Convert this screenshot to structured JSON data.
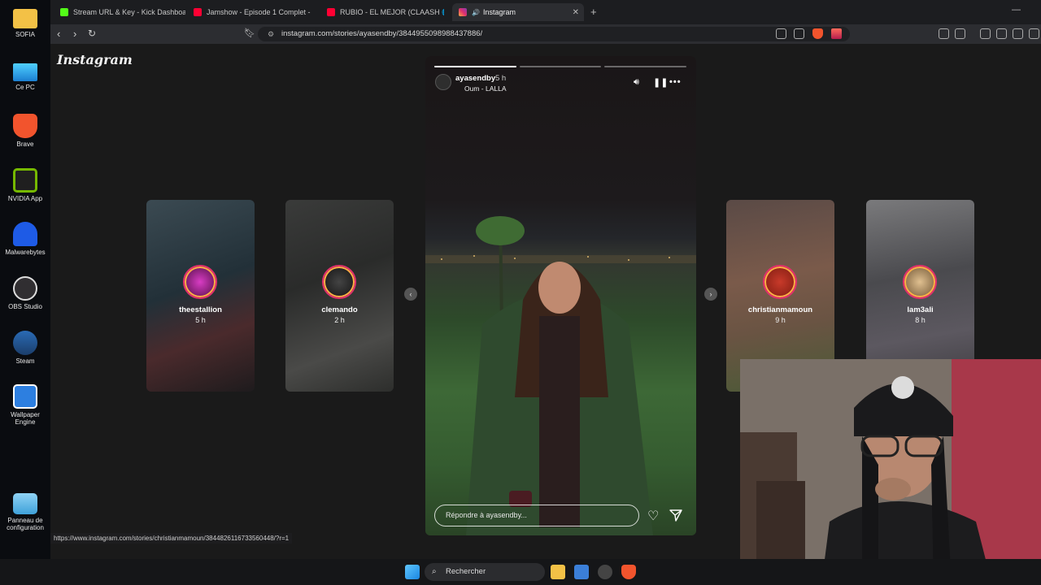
{
  "desktop": {
    "icons": [
      {
        "label": "SOFIA",
        "icon": "folder-icon",
        "color": "#f3c146"
      },
      {
        "label": "Ce PC",
        "icon": "monitor-icon",
        "color": "#2aa7e8"
      },
      {
        "label": "Brave",
        "icon": "brave-icon",
        "color": "#f2542d"
      },
      {
        "label": "NVIDIA App",
        "icon": "nvidia-icon",
        "color": "#76b900"
      },
      {
        "label": "Malwarebytes",
        "icon": "malwarebytes-icon",
        "color": "#1e5be6"
      },
      {
        "label": "OBS Studio",
        "icon": "obs-icon",
        "color": "#302e31"
      },
      {
        "label": "Steam",
        "icon": "steam-icon",
        "color": "#1b3e6b"
      },
      {
        "label": "Wallpaper Engine",
        "icon": "wallpaper-engine-icon",
        "color": "#2d7fe0"
      },
      {
        "label": "Panneau de configuration",
        "icon": "control-panel-icon",
        "color": "#3fa1d9"
      }
    ]
  },
  "browser": {
    "tabs": [
      {
        "title": "Stream URL & Key - Kick Dashboard",
        "icon": "kick-icon",
        "color": "#53fc18"
      },
      {
        "title": "Jamshow - Episode 1 Complet - YouT",
        "icon": "youtube-icon",
        "color": "#ff0033"
      },
      {
        "title": "RUBIO - EL MEJOR (CLAASH 🌐) - Yo",
        "icon": "youtube-icon",
        "color": "#ff0033"
      },
      {
        "title": "Instagram",
        "icon": "instagram-icon",
        "color": "#e1306c"
      }
    ],
    "url": "instagram.com/stories/ayasendby/3844955098988437886/",
    "status_url": "https://www.instagram.com/stories/christianmamoun/3844826116733560448/?r=1"
  },
  "instagram": {
    "logo": "Instagram",
    "current_story": {
      "username": "ayasendby",
      "time": "5 h",
      "music": "Oum - LALLA",
      "reply_placeholder": "Répondre à ayasendby..."
    },
    "side_stories": [
      {
        "username": "theestallion",
        "time": "5 h"
      },
      {
        "username": "clemando",
        "time": "2 h"
      },
      {
        "username": "christianmamoun",
        "time": "9 h"
      },
      {
        "username": "lam3ali",
        "time": "8 h"
      }
    ]
  },
  "taskbar": {
    "search_label": "Rechercher"
  }
}
